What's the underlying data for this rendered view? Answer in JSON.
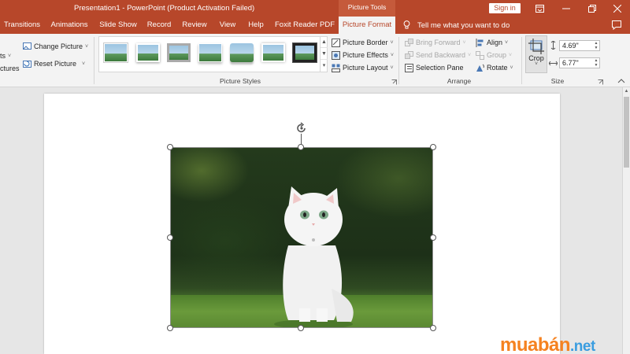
{
  "title_bar": {
    "title": "Presentation1  -  PowerPoint (Product Activation Failed)",
    "contextual_group": "Picture Tools",
    "sign_in": "Sign in"
  },
  "tabs": [
    {
      "label": "Transitions"
    },
    {
      "label": "Animations"
    },
    {
      "label": "Slide Show"
    },
    {
      "label": "Record"
    },
    {
      "label": "Review"
    },
    {
      "label": "View"
    },
    {
      "label": "Help"
    },
    {
      "label": "Foxit Reader PDF"
    },
    {
      "label": "Picture Format",
      "active": true
    }
  ],
  "tell_me": "Tell me what you want to do",
  "ribbon": {
    "adjust": {
      "partial_top": "ts",
      "partial_bottom": "ctures",
      "change_picture": "Change Picture",
      "reset_picture": "Reset Picture"
    },
    "picture_styles": {
      "label": "Picture Styles",
      "picture_border": "Picture Border",
      "picture_effects": "Picture Effects",
      "picture_layout": "Picture Layout"
    },
    "arrange": {
      "label": "Arrange",
      "bring_forward": "Bring Forward",
      "send_backward": "Send Backward",
      "selection_pane": "Selection Pane",
      "align": "Align",
      "group": "Group",
      "rotate": "Rotate"
    },
    "size": {
      "label": "Size",
      "crop": "Crop",
      "height": "4.69\"",
      "width": "6.77\""
    }
  },
  "watermark": {
    "main": "muabán",
    "tld": ".net"
  },
  "colors": {
    "accent": "#b7472a",
    "ribbon_bg": "#f3f3f3",
    "watermark_orange": "#f58220",
    "watermark_blue": "#3a9de0"
  }
}
